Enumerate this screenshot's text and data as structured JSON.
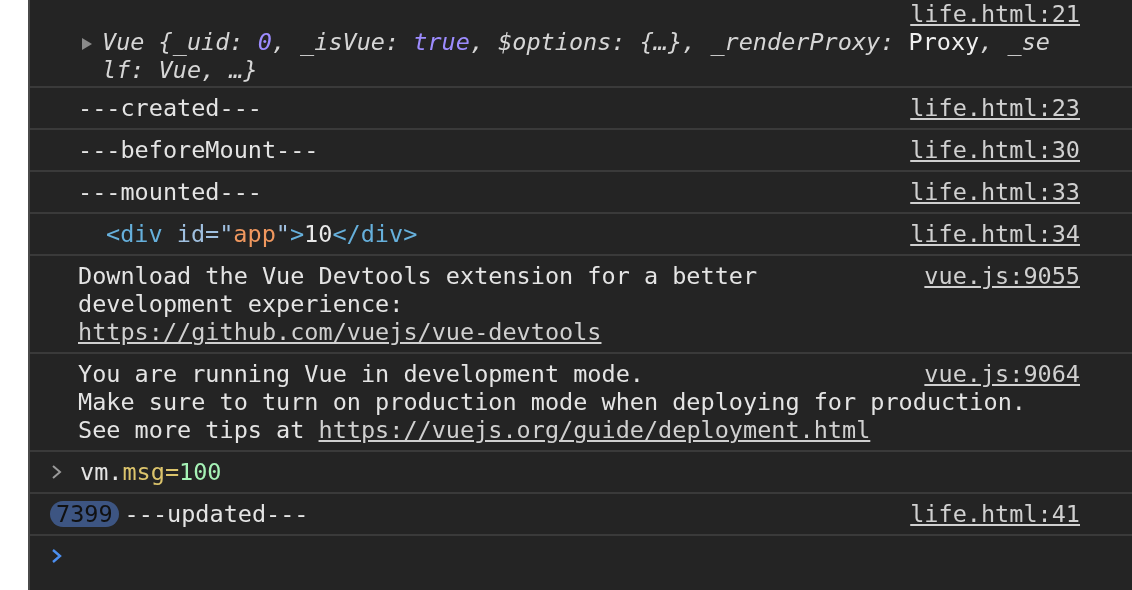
{
  "messages": [
    {
      "kind": "object",
      "source": "life.html:21",
      "tokens": [
        {
          "kind": "italic",
          "text": "Vue {_uid: "
        },
        {
          "kind": "number",
          "text": "0"
        },
        {
          "kind": "italic",
          "text": ", _isVue: "
        },
        {
          "kind": "number",
          "text": "true"
        },
        {
          "kind": "italic",
          "text": ", $options: {…}, _renderProxy: "
        },
        {
          "kind": "value",
          "text": "Proxy"
        },
        {
          "kind": "italic",
          "text": ", _self: Vue, …}"
        }
      ]
    },
    {
      "kind": "log",
      "source": "life.html:23",
      "text": "---created---"
    },
    {
      "kind": "log",
      "source": "life.html:30",
      "text": "---beforeMount---"
    },
    {
      "kind": "log",
      "source": "life.html:33",
      "text": "---mounted---"
    },
    {
      "kind": "element",
      "source": "life.html:34",
      "tokens": [
        {
          "kind": "tag",
          "text": "<div "
        },
        {
          "kind": "attr",
          "text": "id=\""
        },
        {
          "kind": "string",
          "text": "app"
        },
        {
          "kind": "attr",
          "text": "\""
        },
        {
          "kind": "tag",
          "text": ">"
        },
        {
          "kind": "text",
          "text": "10"
        },
        {
          "kind": "tag",
          "text": "</div>"
        }
      ]
    },
    {
      "kind": "lines",
      "source": "vue.js:9055",
      "lines": [
        [
          {
            "kind": "text",
            "text": "Download the Vue Devtools extension for a better\ndevelopment experience:"
          }
        ],
        [
          {
            "kind": "link",
            "text": "https://github.com/vuejs/vue-devtools"
          }
        ]
      ]
    },
    {
      "kind": "lines",
      "source": "vue.js:9064",
      "lines": [
        [
          {
            "kind": "text",
            "text": "You are running Vue in development mode."
          }
        ],
        [
          {
            "kind": "text",
            "text": "Make sure to turn on production mode when deploying for production."
          }
        ],
        [
          {
            "kind": "text",
            "text": "See more tips at "
          },
          {
            "kind": "link",
            "text": "https://vuejs.org/guide/deployment.html"
          }
        ]
      ]
    },
    {
      "kind": "input",
      "tokens": [
        {
          "kind": "plain",
          "text": "vm."
        },
        {
          "kind": "property",
          "text": "msg="
        },
        {
          "kind": "literal",
          "text": "100"
        }
      ]
    },
    {
      "kind": "repeat",
      "source": "life.html:41",
      "count": "7399",
      "text": "---updated---"
    },
    {
      "kind": "prompt"
    }
  ]
}
